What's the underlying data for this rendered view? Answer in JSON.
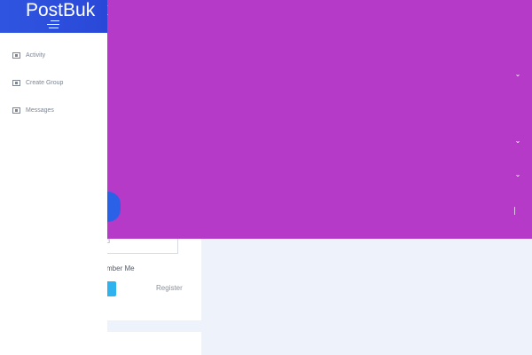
{
  "brand": {
    "name": "PostBuk"
  },
  "sidebar": {
    "items": [
      {
        "label": "Activity"
      },
      {
        "label": "Create Group"
      },
      {
        "label": "Messages"
      }
    ]
  },
  "overlay": {
    "close_glyph": "x"
  },
  "login": {
    "password_placeholder": "rd",
    "remember_label": "mber Me",
    "register_label": "Register"
  },
  "icons": {
    "chevron": "chevron-down-icon",
    "menu": "menu-icon",
    "nav": "nav-list-icon"
  },
  "colors": {
    "overlay": "#b53ac8",
    "brand": "#2f55e0",
    "login_button": "#2fb3ef",
    "page_background": "#eef2fa"
  }
}
